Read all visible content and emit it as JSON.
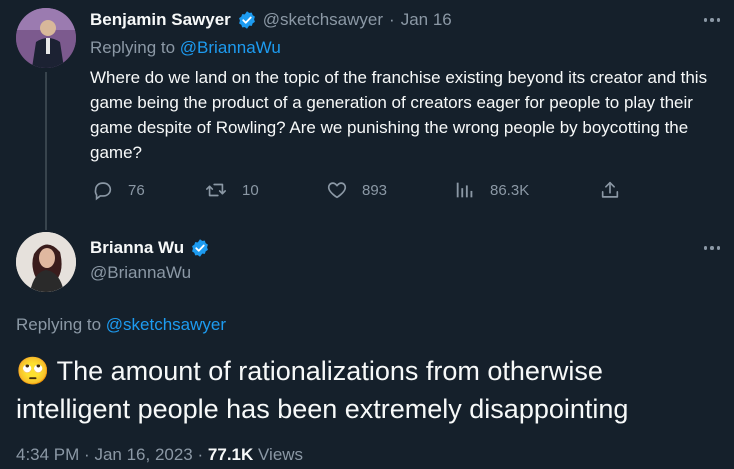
{
  "tweet1": {
    "name": "Benjamin Sawyer",
    "handle": "@sketchsawyer",
    "separator": "·",
    "date": "Jan 16",
    "replying_label": "Replying to",
    "replying_to": "@BriannaWu",
    "body": "Where do we land on the topic of the franchise existing beyond its creator and this game being the product of a generation of creators eager for people to play their game despite of Rowling? Are we punishing the wrong people by boycotting the game?",
    "stats": {
      "replies": "76",
      "retweets": "10",
      "likes": "893",
      "views": "86.3K"
    }
  },
  "tweet2": {
    "name": "Brianna Wu",
    "handle": "@BriannaWu",
    "replying_label": "Replying to",
    "replying_to": "@sketchsawyer",
    "emoji": "🙄",
    "body": "The amount of rationalizations from otherwise intelligent people has been extremely disappointing",
    "time": "4:34 PM",
    "sep1": "·",
    "date": "Jan 16, 2023",
    "sep2": "·",
    "views_count": "77.1K",
    "views_label": "Views"
  },
  "colors": {
    "background": "#15202b",
    "text": "#f7f9f9",
    "muted": "#8b98a5",
    "accent": "#1d9bf0"
  },
  "icons": [
    "verified-badge-icon",
    "more-icon",
    "reply-icon",
    "retweet-icon",
    "like-icon",
    "views-icon",
    "share-icon"
  ]
}
